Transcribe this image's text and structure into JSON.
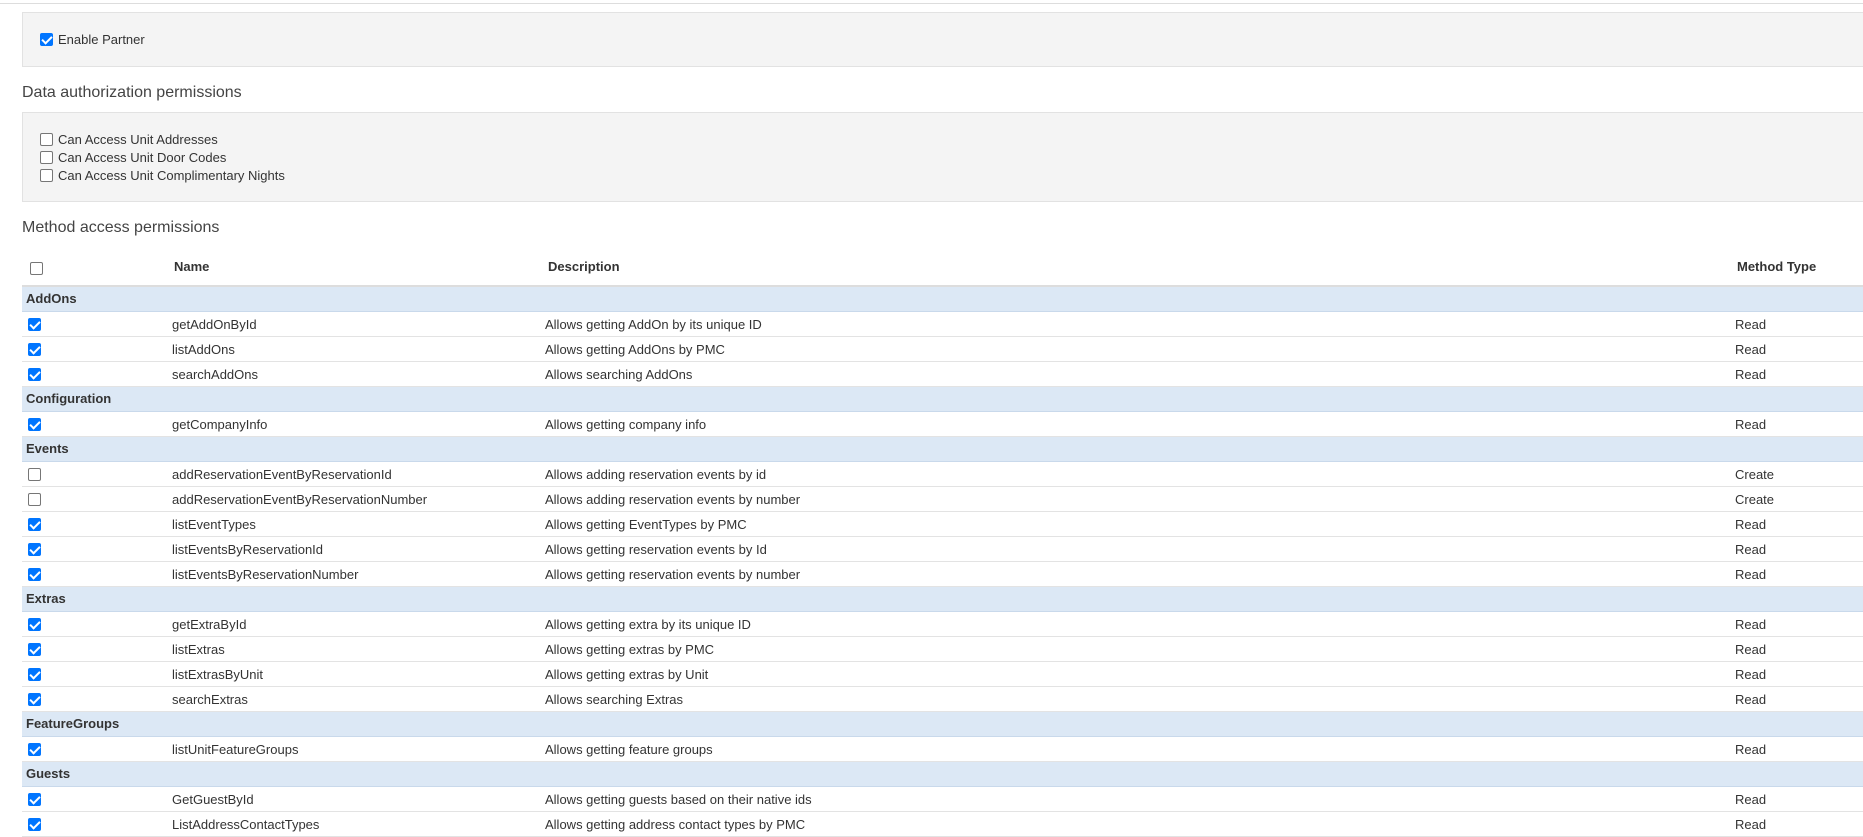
{
  "partner": {
    "enable_label": "Enable Partner",
    "enabled": true
  },
  "data_auth": {
    "title": "Data authorization permissions",
    "items": [
      {
        "label": "Can Access Unit Addresses",
        "checked": false
      },
      {
        "label": "Can Access Unit Door Codes",
        "checked": false
      },
      {
        "label": "Can Access Unit Complimentary Nights",
        "checked": false
      }
    ]
  },
  "method_access": {
    "title": "Method access permissions",
    "select_all_checked": false,
    "columns": {
      "name": "Name",
      "description": "Description",
      "method_type": "Method Type"
    },
    "groups": [
      {
        "label": "AddOns",
        "rows": [
          {
            "name": "getAddOnById",
            "description": "Allows getting AddOn by its unique ID",
            "type": "Read",
            "checked": true
          },
          {
            "name": "listAddOns",
            "description": "Allows getting AddOns by PMC",
            "type": "Read",
            "checked": true
          },
          {
            "name": "searchAddOns",
            "description": "Allows searching AddOns",
            "type": "Read",
            "checked": true
          }
        ]
      },
      {
        "label": "Configuration",
        "rows": [
          {
            "name": "getCompanyInfo",
            "description": "Allows getting company info",
            "type": "Read",
            "checked": true
          }
        ]
      },
      {
        "label": "Events",
        "rows": [
          {
            "name": "addReservationEventByReservationId",
            "description": "Allows adding reservation events by id",
            "type": "Create",
            "checked": false
          },
          {
            "name": "addReservationEventByReservationNumber",
            "description": "Allows adding reservation events by number",
            "type": "Create",
            "checked": false
          },
          {
            "name": "listEventTypes",
            "description": "Allows getting EventTypes by PMC",
            "type": "Read",
            "checked": true
          },
          {
            "name": "listEventsByReservationId",
            "description": "Allows getting reservation events by Id",
            "type": "Read",
            "checked": true
          },
          {
            "name": "listEventsByReservationNumber",
            "description": "Allows getting reservation events by number",
            "type": "Read",
            "checked": true
          }
        ]
      },
      {
        "label": "Extras",
        "rows": [
          {
            "name": "getExtraById",
            "description": "Allows getting extra by its unique ID",
            "type": "Read",
            "checked": true
          },
          {
            "name": "listExtras",
            "description": "Allows getting extras by PMC",
            "type": "Read",
            "checked": true
          },
          {
            "name": "listExtrasByUnit",
            "description": "Allows getting extras by Unit",
            "type": "Read",
            "checked": true
          },
          {
            "name": "searchExtras",
            "description": "Allows searching Extras",
            "type": "Read",
            "checked": true
          }
        ]
      },
      {
        "label": "FeatureGroups",
        "rows": [
          {
            "name": "listUnitFeatureGroups",
            "description": "Allows getting feature groups",
            "type": "Read",
            "checked": true
          }
        ]
      },
      {
        "label": "Guests",
        "rows": [
          {
            "name": "GetGuestById",
            "description": "Allows getting guests based on their native ids",
            "type": "Read",
            "checked": true
          },
          {
            "name": "ListAddressContactTypes",
            "description": "Allows getting address contact types by PMC",
            "type": "Read",
            "checked": true
          }
        ]
      }
    ]
  },
  "colors": {
    "group_bg": "#dce8f5",
    "panel_bg": "#f4f4f4",
    "checkbox_checked": "#0075ff"
  }
}
